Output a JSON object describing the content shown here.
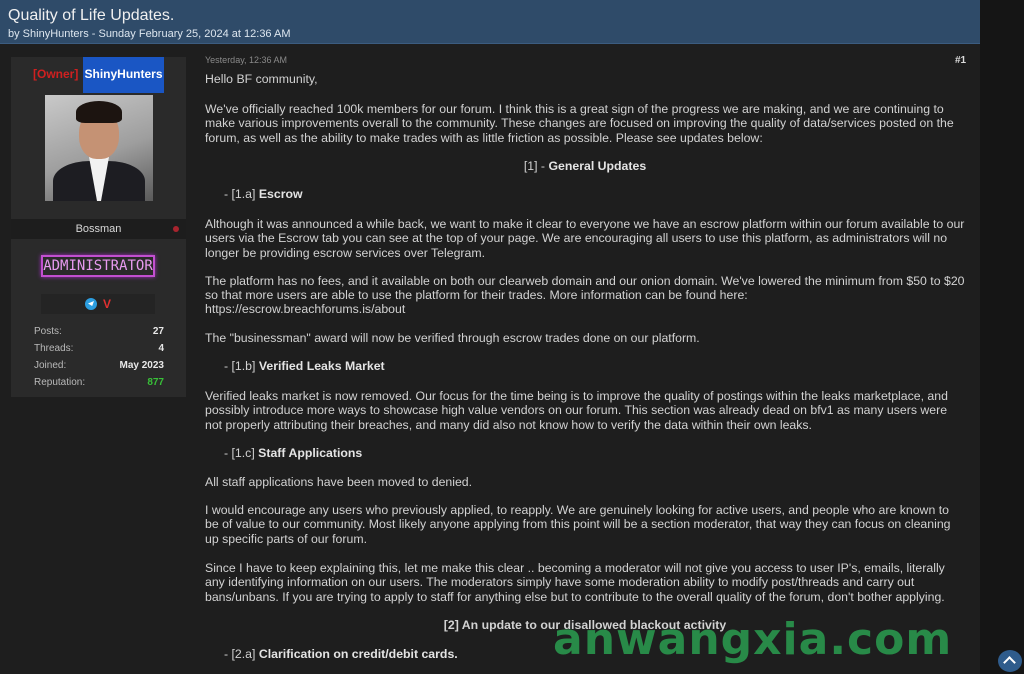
{
  "thread": {
    "title": "Quality of Life Updates.",
    "meta": "by ShinyHunters - Sunday February 25, 2024 at 12:36 AM"
  },
  "user": {
    "owner_tag": "[Owner]",
    "display_name": "ShinyHunters",
    "username": "Bossman",
    "role": "ADMINISTRATOR",
    "contact_icons": [
      "telegram-icon",
      "vx-icon"
    ],
    "stats": [
      {
        "label": "Posts:",
        "value": "27"
      },
      {
        "label": "Threads:",
        "value": "4"
      },
      {
        "label": "Joined:",
        "value": "May 2023"
      },
      {
        "label": "Reputation:",
        "value": "877"
      }
    ],
    "colors": {
      "owner": "#d02020",
      "name_bg": "#1a56c4",
      "role_border": "#c24fd0",
      "reputation": "#38c038"
    }
  },
  "post": {
    "date": "Yesterday, 12:36 AM",
    "number": "#1",
    "greeting": "Hello BF community,",
    "intro": "We've officially reached 100k members for our forum. I think this is a great sign of the progress we are making, and we are continuing to make various improvements overall to the community. These changes are focused on improving the quality of data/services posted on the forum, as well as the ability to make trades with as little friction as possible. Please see updates below:",
    "section1_prefix": "[1] - ",
    "section1_title": "General Updates",
    "sub_1a_prefix": "- [1.a] ",
    "sub_1a_title": "Escrow",
    "escrow_p1": "Although it was announced a while back, we want to make it clear to everyone we have an escrow platform within our forum available to our users via the Escrow tab you can see at the top of your page. We are encouraging all users to use this platform, as administrators will no longer be providing escrow services over Telegram.",
    "escrow_p2": "The platform has no fees, and it available on both our clearweb domain and our onion domain. We've lowered the minimum from $50 to $20 so that more users are able to use the platform for their trades. More information can be found here:",
    "escrow_link": "https://escrow.breachforums.is/about",
    "escrow_p3": "The \"businessman\" award will now be verified through escrow trades done on our platform.",
    "sub_1b_prefix": "- [1.b] ",
    "sub_1b_title": "Verified Leaks Market",
    "leaks_p": "Verified leaks market is now removed. Our focus for the time being is to improve the quality of postings within the leaks marketplace, and possibly introduce more ways to showcase high value vendors on our forum. This section was already dead on bfv1 as many users were not properly attributing their breaches, and many did also not know how to verify the data within their own leaks.",
    "sub_1c_prefix": "- [1.c] ",
    "sub_1c_title": "Staff Applications",
    "staff_p1": "All staff applications have been moved to denied.",
    "staff_p2": "I would encourage any users who previously applied, to reapply. We are genuinely looking for active users, and people who are known to be of value to our community. Most likely anyone applying from this point will be a section moderator, that way they can focus on cleaning up specific parts of our forum.",
    "staff_p3": "Since I have to keep explaining this, let me make this clear .. becoming a moderator will not give you access to user IP's, emails, literally any identifying information on our users. The moderators simply have some moderation ability to modify post/threads and carry out bans/unbans. If you are trying to apply to staff for anything else but to contribute to the overall quality of the forum, don't bother applying.",
    "section2_title": "[2] An update to our disallowed blackout activity",
    "sub_2a_prefix": "- [2.a] ",
    "sub_2a_title": "Clarification on credit/debit cards."
  },
  "watermark": "anwangxia.com"
}
